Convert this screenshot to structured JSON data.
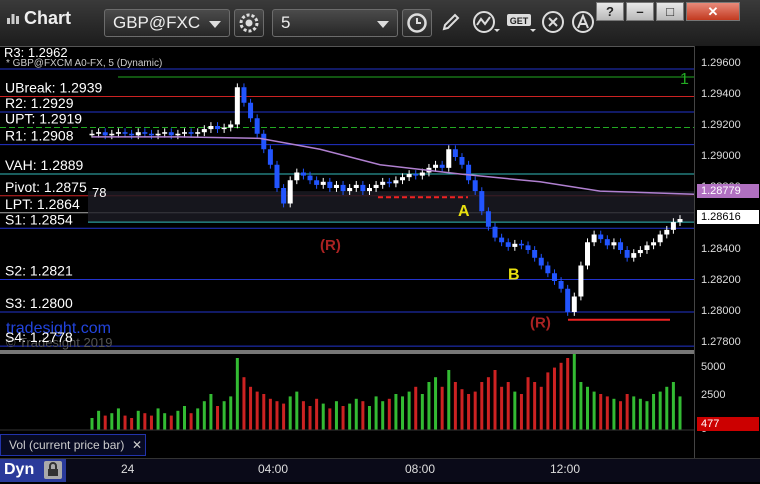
{
  "window": {
    "title": "Chart"
  },
  "toolbar": {
    "symbol": "GBP@FXC",
    "interval": "5",
    "window_buttons": [
      "?",
      "–",
      "□",
      "✕"
    ]
  },
  "chart": {
    "header_label": "* GBP@FXCM A0-FX, 5 (Dynamic)",
    "top_level_label": "R3: 1.2962",
    "levels": [
      {
        "name": "UBreak: 1.2939",
        "value": 1.2939,
        "color": "#cc2222"
      },
      {
        "name": "R2: 1.2929",
        "value": 1.2929,
        "color": "#2233cc"
      },
      {
        "name": "UPT: 1.2919",
        "value": 1.2919,
        "color": "#22aa22",
        "dashed": true
      },
      {
        "name": "R1: 1.2908",
        "value": 1.2908,
        "color": "#2233cc"
      },
      {
        "name": "VAH: 1.2889",
        "value": 1.2889,
        "color": "#33bbbb"
      },
      {
        "name": "Pivot: 1.2875",
        "value": 1.2875,
        "color": "#cc2222"
      },
      {
        "name": "LPT: 1.2864",
        "value": 1.2864,
        "color": "#aaaaaa"
      },
      {
        "name": "S1: 1.2854",
        "value": 1.2854,
        "color": "#2233cc"
      },
      {
        "name": "S2: 1.2821",
        "value": 1.2821,
        "color": "#2233cc"
      },
      {
        "name": "S3: 1.2800",
        "value": 1.28,
        "color": "#2233cc"
      },
      {
        "name": "S4: 1.2778",
        "value": 1.2778,
        "color": "#2233cc"
      }
    ],
    "overlay_value_text": "78",
    "annotations": {
      "a": "A",
      "b": "B",
      "r": "(R)",
      "one": "1"
    },
    "watermark_site": "tradesight.com",
    "watermark_copy": "© Tradesight 2019",
    "price_axis": [
      "1.29600",
      "1.29400",
      "1.29200",
      "1.29000",
      "1.28800",
      "1.28600",
      "1.28400",
      "1.28200",
      "1.28000",
      "1.27800"
    ],
    "price_tags": {
      "upper": "1.28779",
      "current": "1.28616"
    },
    "volume_axis": [
      "5000",
      "2500",
      "0"
    ],
    "volume_tag": "477",
    "volume_legend": "Vol (current price bar)",
    "time_axis": [
      "24",
      "04:00",
      "08:00",
      "12:00"
    ],
    "dyn_label": "Dyn"
  },
  "colors": {
    "bull": "#ffffff",
    "bear": "#2255ff",
    "vwap": "#b080d0",
    "sell_setup": "#22aa22"
  }
}
